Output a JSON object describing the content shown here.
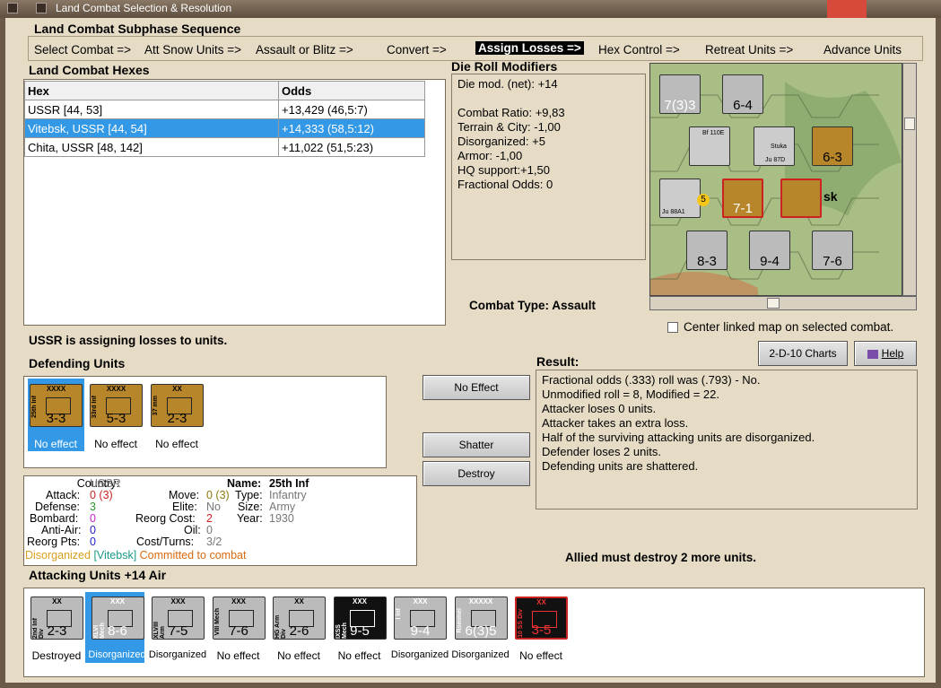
{
  "window": {
    "title": "Land Combat Selection & Resolution"
  },
  "subphase": {
    "title": "Land Combat Subphase Sequence",
    "steps": [
      "Select Combat =>",
      "Att Snow Units =>",
      "Assault or Blitz =>",
      "Convert =>",
      "Assign Losses =>",
      "Hex Control =>",
      "Retreat Units =>",
      "Advance Units"
    ],
    "active": "Assign Losses =>"
  },
  "hexes": {
    "title": "Land Combat Hexes",
    "headers": [
      "Hex",
      "Odds"
    ],
    "rows": [
      [
        "USSR [44, 53]",
        "+13,429 (46,5:7)"
      ],
      [
        "Vitebsk, USSR [44, 54]",
        "+14,333 (58,5:12)"
      ],
      [
        "Chita, USSR [48, 142]",
        "+11,022 (51,5:23)"
      ]
    ]
  },
  "drm": {
    "title": "Die Roll Modifiers",
    "lines": [
      "Die mod. (net): +14",
      "",
      "Combat Ratio: +9,83",
      "Terrain & City: -1,00",
      "Disorganized: +5",
      "Armor: -1,00",
      "HQ support:+1,50",
      "Fractional Odds: 0"
    ]
  },
  "combat_type": "Combat Type:  Assault",
  "center_map": "Center linked map on selected combat.",
  "status": "USSR is assigning losses to units.",
  "buttons": {
    "charts": "2-D-10 Charts",
    "help": "Help",
    "no_effect": "No Effect",
    "shatter": "Shatter",
    "destroy": "Destroy"
  },
  "defending": {
    "title": "Defending Units",
    "units": [
      {
        "size": "XXXX",
        "name": "25th Inf",
        "value": "3-3",
        "caption": "No effect"
      },
      {
        "size": "XXXX",
        "name": "33rd Inf",
        "value": "5-3",
        "caption": "No effect"
      },
      {
        "size": "XX",
        "name": "37 mm",
        "value": "2-3",
        "caption": "No effect"
      }
    ]
  },
  "unit_info": {
    "country_l": "Country:",
    "country": "USSR",
    "name_l": "Name:",
    "name": "25th Inf",
    "attack_l": "Attack:",
    "attack": "0 (3)",
    "move_l": "Move:",
    "move": "0 (3)",
    "type_l": "Type:",
    "type": "Infantry",
    "defense_l": "Defense:",
    "defense": "3",
    "elite_l": "Elite:",
    "elite": "No",
    "size_l": "Size:",
    "size": "Army",
    "bombard_l": "Bombard:",
    "bombard": "0",
    "reorg_cost_l": "Reorg Cost:",
    "reorg_cost": "2",
    "year_l": "Year:",
    "year": "1930",
    "antiair_l": "Anti-Air:",
    "antiair": "0",
    "oil_l": "Oil:",
    "oil": "0",
    "reorg_pts_l": "Reorg Pts:",
    "reorg_pts": "0",
    "cost_turns_l": "Cost/Turns:",
    "cost_turns": "3/2",
    "status1": "Disorganized",
    "status2": "[Vitebsk]",
    "status3": "Committed to combat"
  },
  "result": {
    "title": "Result:",
    "lines": [
      "Fractional odds (.333) roll was (.793)  - No.",
      "Unmodified roll = 8, Modified = 22.",
      "Attacker loses 0 units.",
      "Attacker takes an extra loss.",
      "Half of the surviving attacking units are disorganized.",
      "Defender loses 2 units.",
      "Defending units are shattered."
    ]
  },
  "allied_msg": "Allied must destroy 2 more units.",
  "attacking": {
    "title": "Attacking Units +14 Air",
    "units": [
      {
        "size": "XX",
        "name": "2nd Inf Div",
        "value": "2-3",
        "caption": "Destroyed"
      },
      {
        "size": "XXX",
        "name": "XLVI Mech",
        "value": "8-6",
        "caption": "Disorganized"
      },
      {
        "size": "XXX",
        "name": "XLVIII Arm",
        "value": "7-5",
        "caption": "Disorganized"
      },
      {
        "size": "XXX",
        "name": "VIII Mech",
        "value": "7-6",
        "caption": "No effect"
      },
      {
        "size": "XX",
        "name": "HG Arm Div",
        "value": "2-6",
        "caption": "No effect"
      },
      {
        "size": "XXX",
        "name": "IXSS Mech",
        "value": "9-5",
        "caption": "No effect"
      },
      {
        "size": "XXX",
        "name": "I Inf",
        "value": "9-4",
        "caption": "Disorganized"
      },
      {
        "size": "XXXXX",
        "name": "Rommel",
        "value": "6(3)5",
        "caption": "Disorganized"
      },
      {
        "size": "XX",
        "name": "10 SS Div",
        "value": "3-5",
        "caption": "No effect"
      }
    ]
  },
  "map": {
    "labels": [
      "7(3)3",
      "6-4",
      "6-3",
      "7-1",
      "8-3",
      "9-4",
      "7-6",
      "5",
      "sk",
      "Ju 88A1",
      "Bf 110E",
      "Ju 87D",
      "Stuka"
    ]
  }
}
